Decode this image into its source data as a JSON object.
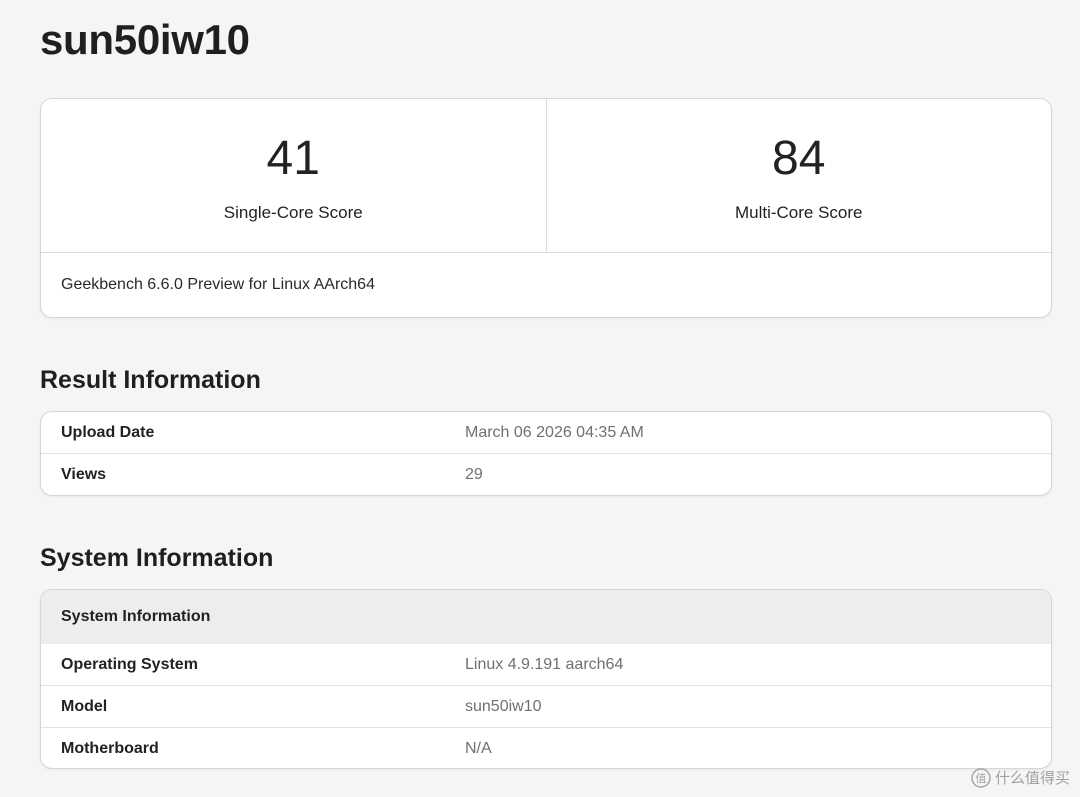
{
  "page": {
    "title": "sun50iw10"
  },
  "scores": {
    "single_core": {
      "value": "41",
      "label": "Single-Core Score"
    },
    "multi_core": {
      "value": "84",
      "label": "Multi-Core Score"
    },
    "version": "Geekbench 6.6.0 Preview for Linux AArch64"
  },
  "result_information": {
    "heading": "Result Information",
    "rows": [
      {
        "label": "Upload Date",
        "value": "March 06 2026 04:35 AM"
      },
      {
        "label": "Views",
        "value": "29"
      }
    ]
  },
  "system_information": {
    "heading": "System Information",
    "table_header": "System Information",
    "rows": [
      {
        "label": "Operating System",
        "value": "Linux 4.9.191 aarch64"
      },
      {
        "label": "Model",
        "value": "sun50iw10"
      },
      {
        "label": "Motherboard",
        "value": "N/A"
      }
    ]
  },
  "watermark": {
    "text": "什么值得买",
    "icon": "smzdm-logo-icon"
  },
  "colors": {
    "background": "#f5f5f5",
    "card": "#ffffff",
    "border": "#d6d6d6",
    "muted_text": "#707070",
    "header_fill": "#ededed"
  }
}
